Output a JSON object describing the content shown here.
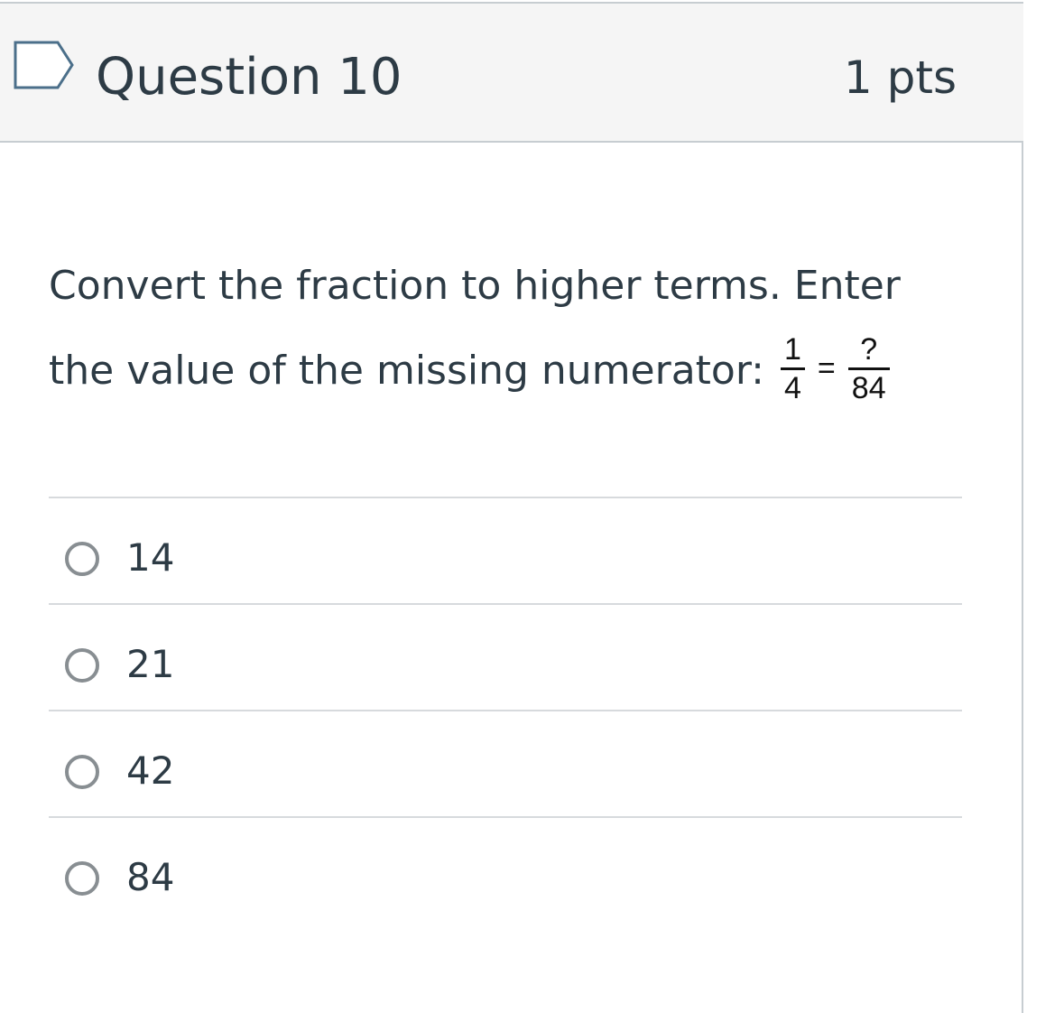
{
  "question": {
    "title": "Question 10",
    "points": "1 pts",
    "text_line1": "Convert the fraction to higher terms. Enter",
    "text_line2": "the value of the missing numerator:",
    "fraction": {
      "left_numerator": "1",
      "left_denominator": "4",
      "equals": "=",
      "right_numerator": "?",
      "right_denominator": "84"
    }
  },
  "answers": [
    {
      "label": "14"
    },
    {
      "label": "21"
    },
    {
      "label": "42"
    },
    {
      "label": "84"
    }
  ],
  "colors": {
    "header_bg": "#f5f5f5",
    "border": "#c7cdd1",
    "text": "#2d3b45",
    "flag_stroke": "#4b6f8a"
  },
  "icons": {
    "flag": "bookmark-flag-icon",
    "radio": "radio-unselected-icon"
  }
}
